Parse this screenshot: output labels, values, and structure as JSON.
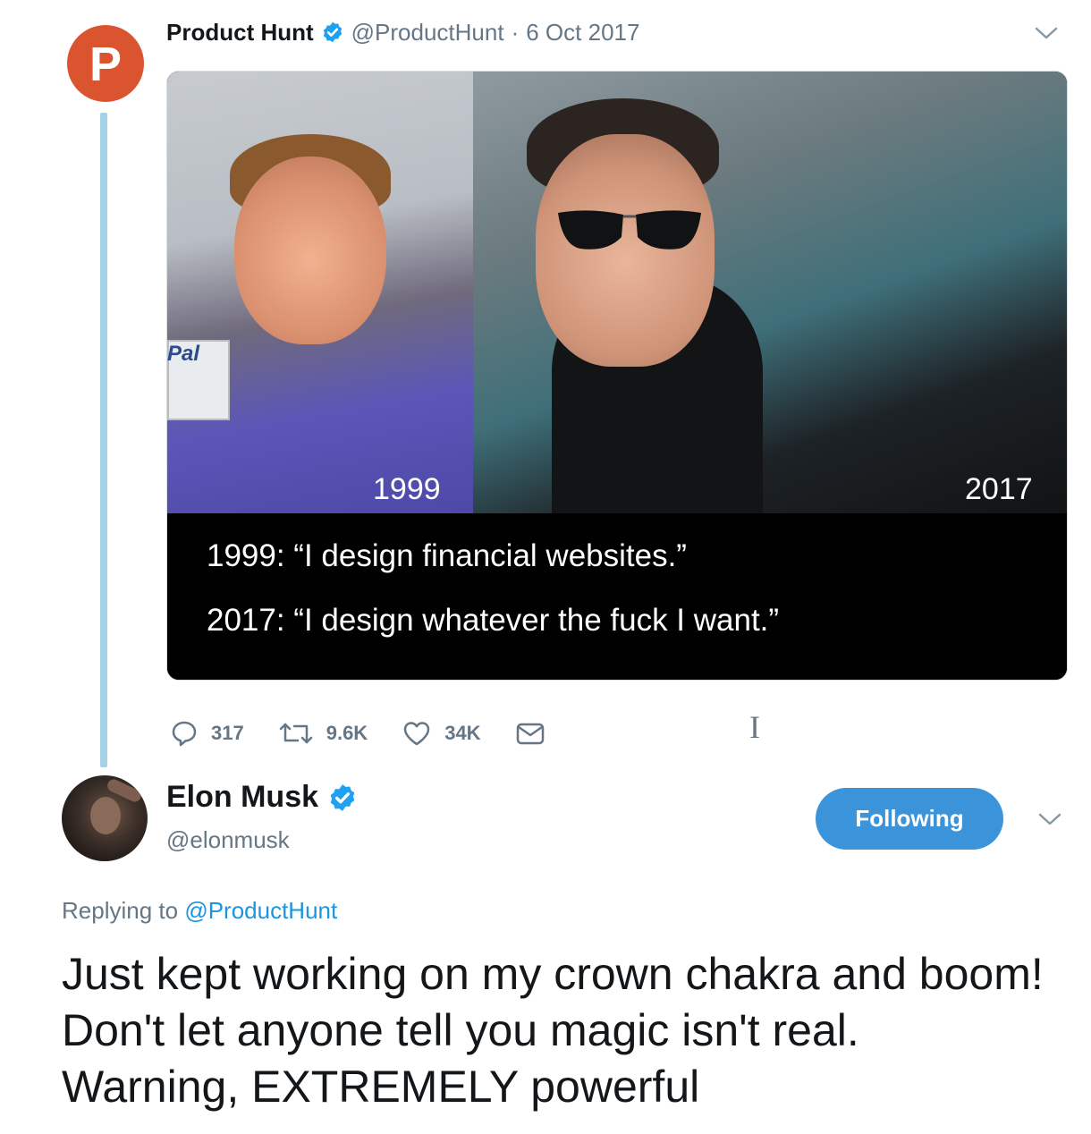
{
  "original_tweet": {
    "author_name": "Product Hunt",
    "avatar_letter": "P",
    "handle": "@ProductHunt",
    "separator": "·",
    "date": "6 Oct 2017",
    "media": {
      "left_year": "1999",
      "right_year": "2017",
      "caption_line_1": "1999: “I design financial websites.”",
      "caption_line_2": "2017: “I design whatever the fuck I want.”",
      "sign_text": "Pal"
    },
    "actions": {
      "replies": "317",
      "retweets": "9.6K",
      "likes": "34K"
    }
  },
  "reply_tweet": {
    "author_name": "Elon Musk",
    "handle": "@elonmusk",
    "follow_button": "Following",
    "replying_prefix": "Replying to",
    "replying_to": "@ProductHunt",
    "text": "Just kept working on my crown chakra and boom! Don't let anyone tell you magic isn't real. Warning, EXTREMELY powerful"
  },
  "colors": {
    "verified_blue": "#1da1f2",
    "follow_button": "#3b94d9",
    "product_hunt_orange": "#da552f",
    "thread_line": "#a6d2e6",
    "link_blue": "#1b95e0",
    "muted_text": "#657786"
  },
  "icons": [
    "verified-badge-icon",
    "chevron-down-icon",
    "reply-icon",
    "retweet-icon",
    "like-icon",
    "message-icon",
    "text-cursor-icon"
  ]
}
